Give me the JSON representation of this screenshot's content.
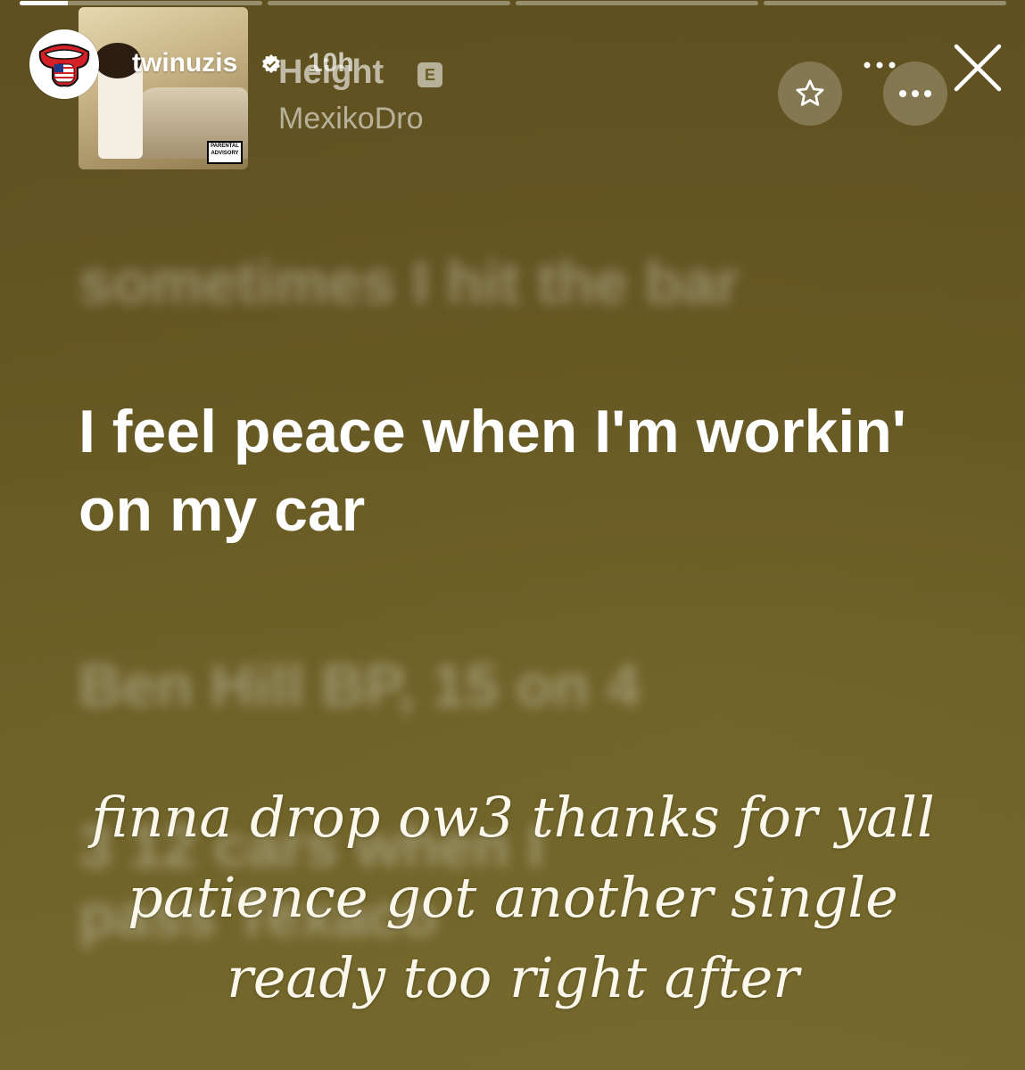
{
  "story": {
    "username": "twinuzis",
    "time_ago": "10h",
    "progress_segments": [
      0.2,
      0,
      0,
      0
    ],
    "caption": "finna drop ow3 thanks for yall patience got another single ready too right after"
  },
  "song": {
    "title": "Height",
    "explicit_badge": "E",
    "artist": "MexikoDro",
    "album_advisory": "PARENTAL ADVISORY"
  },
  "lyrics": {
    "previous": "sometimes I hit the bar",
    "current": "I feel peace when I'm workin' on my car",
    "next": "Ben Hill BP, 15 on 4",
    "next2_line1": "3 12 cars when I",
    "next2_line2": "pass Texaco"
  },
  "icons": {
    "avatar": "rolling-tongue-logo",
    "verified": "verified-badge-icon",
    "star": "star-icon",
    "more": "more-icon",
    "close": "close-icon"
  },
  "colors": {
    "background": "#6a5b25",
    "text_primary": "#ffffff"
  }
}
